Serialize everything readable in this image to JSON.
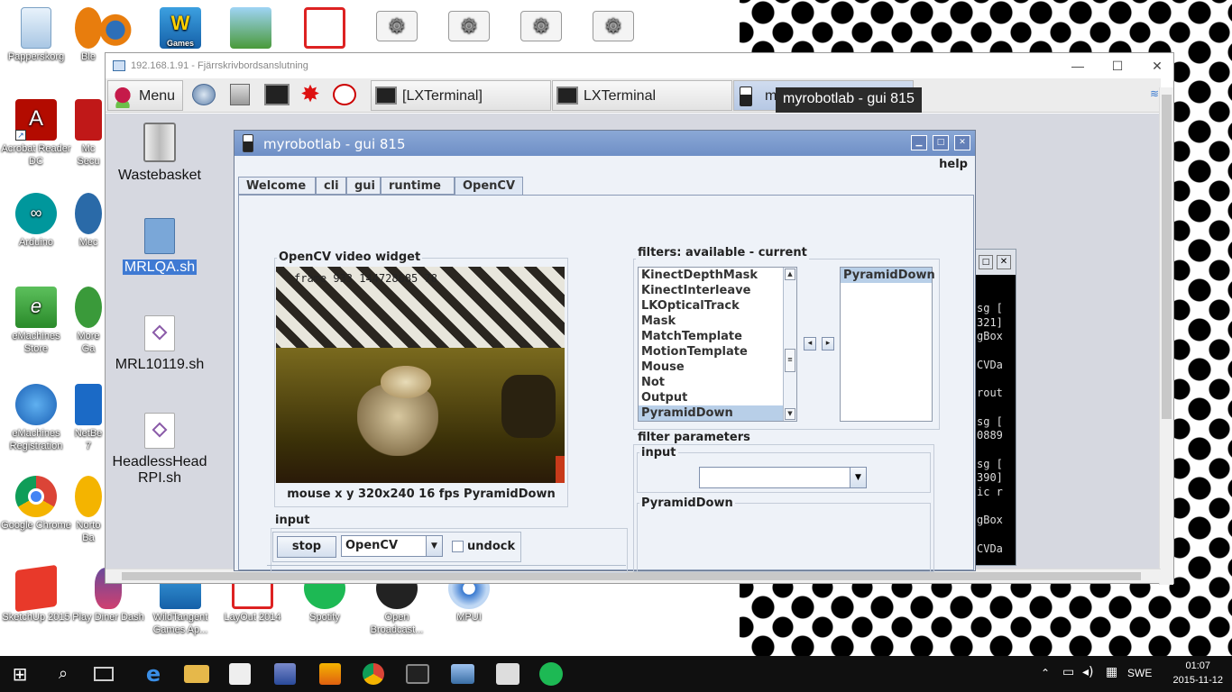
{
  "desktop": {
    "icons_left": [
      {
        "label": "Papperskorg"
      },
      {
        "label": "Acrobat Reader DC"
      },
      {
        "label": "Arduino"
      },
      {
        "label": "eMachines Store"
      },
      {
        "label": "eMachines Registration"
      },
      {
        "label": "Google Chrome"
      },
      {
        "label": "SketchUp 2015"
      }
    ],
    "icons_col2": [
      {
        "label": "Ble"
      },
      {
        "label": "Mc Secu"
      },
      {
        "label": "Mec"
      },
      {
        "label": "More Ga"
      },
      {
        "label": "NetBe 7"
      },
      {
        "label": "Norto Ba"
      },
      {
        "label": "Play Diner Dash"
      }
    ],
    "icons_bottom": [
      {
        "label": "WildTangent Games Ap..."
      },
      {
        "label": "LayOut 2014"
      },
      {
        "label": "Spotify"
      },
      {
        "label": "Open Broadcast..."
      },
      {
        "label": "MPUI"
      }
    ],
    "top_icon_badge": "Games"
  },
  "rdp": {
    "title": "192.168.1.91 - Fjärrskrivbordsanslutning",
    "minimize": "—",
    "maximize": "☐",
    "close": "✕"
  },
  "panel": {
    "menu_label": "Menu",
    "tasks": [
      {
        "label": "[LXTerminal]"
      },
      {
        "label": "LXTerminal"
      },
      {
        "label": "m"
      }
    ]
  },
  "tooltip": "myrobotlab - gui 815",
  "lxdesktop": {
    "icons": [
      {
        "label": "Wastebasket"
      },
      {
        "label": "MRLQA.sh"
      },
      {
        "label": "MRL10119.sh"
      },
      {
        "label": "HeadlessHeadRPI.sh"
      }
    ]
  },
  "mrl": {
    "title": "myrobotlab - gui 815",
    "menu_help": "help",
    "tabs": [
      {
        "label": "Welcome"
      },
      {
        "label": "cli"
      },
      {
        "label": "gui"
      },
      {
        "label": "runtime"
      },
      {
        "label": "OpenCV"
      }
    ],
    "video": {
      "group_label": "OpenCV  video widget",
      "overlay_text": "frame 933 144728685 78",
      "status": "mouse x y 320x240 16 fps PyramidDown"
    },
    "filters": {
      "group_label": "filters: available - current",
      "available": [
        "KinectDepthMask",
        "KinectInterleave",
        "LKOpticalTrack",
        "Mask",
        "MatchTemplate",
        "MotionTemplate",
        "Mouse",
        "Not",
        "Output",
        "PyramidDown"
      ],
      "selected_available": "PyramidDown",
      "current": [
        "PyramidDown"
      ],
      "arrow_left": "◂",
      "arrow_right": "▸"
    },
    "filter_params": {
      "group_label": "filter parameters",
      "input_label": "input",
      "input_value": "",
      "pyramid_label": "PyramidDown"
    },
    "input": {
      "group_label": "input",
      "stop_label": "stop",
      "source_value": "OpenCV",
      "undock_label": "undock"
    }
  },
  "terminal_partial": {
    "lines": [
      "sg [",
      "321]",
      "gBox",
      "",
      "CVDa",
      "",
      "rout",
      "",
      "sg [",
      "0889",
      "",
      "sg [",
      "390]",
      "ic r",
      "",
      "gBox",
      "",
      "CVDa"
    ]
  },
  "taskbar": {
    "language": "SWE",
    "time": "01:07",
    "date": "2015-11-12"
  }
}
